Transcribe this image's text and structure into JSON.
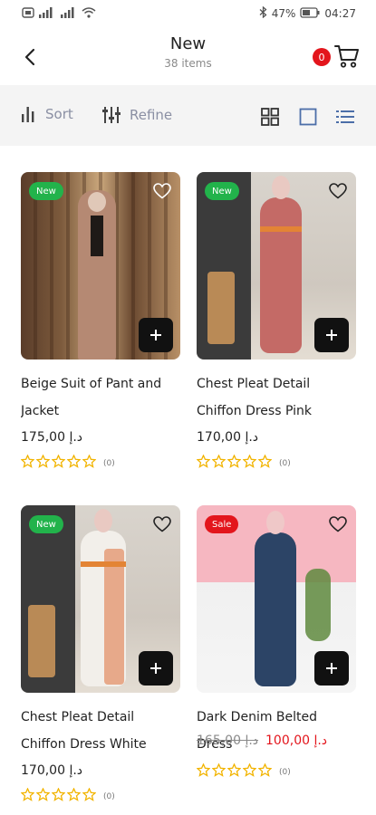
{
  "status_bar": {
    "battery": "47%",
    "time": "04:27",
    "network": "4G"
  },
  "header": {
    "title": "New",
    "count": "38 items",
    "cart_count": "0"
  },
  "toolbar": {
    "sort_label": "Sort",
    "refine_label": "Refine",
    "views": [
      "grid-2x2-icon",
      "single-square-icon",
      "list-icon"
    ]
  },
  "colors": {
    "accent_red": "#e3151c",
    "new_badge_green": "#22b34b",
    "star_yellow": "#f2b400",
    "toolbar_bg": "#f4f4f4"
  },
  "products": [
    {
      "name": "Beige Suit of Pant and Jacket",
      "badge": "New",
      "price": "175,00 د.إ",
      "old_price": "",
      "rating_stars": 0,
      "review_count": "(0)"
    },
    {
      "name": "Chest Pleat Detail Chiffon Dress Pink",
      "badge": "New",
      "price": "170,00 د.إ",
      "old_price": "",
      "rating_stars": 0,
      "review_count": "(0)"
    },
    {
      "name": "Chest Pleat Detail Chiffon Dress White",
      "badge": "New",
      "price": "170,00 د.إ",
      "old_price": "",
      "rating_stars": 0,
      "review_count": "(0)"
    },
    {
      "name": "Dark Denim Belted Dress",
      "badge": "Sale",
      "price": "100,00 د.إ",
      "old_price": "165,00 د.إ",
      "rating_stars": 0,
      "review_count": "(0)"
    }
  ]
}
